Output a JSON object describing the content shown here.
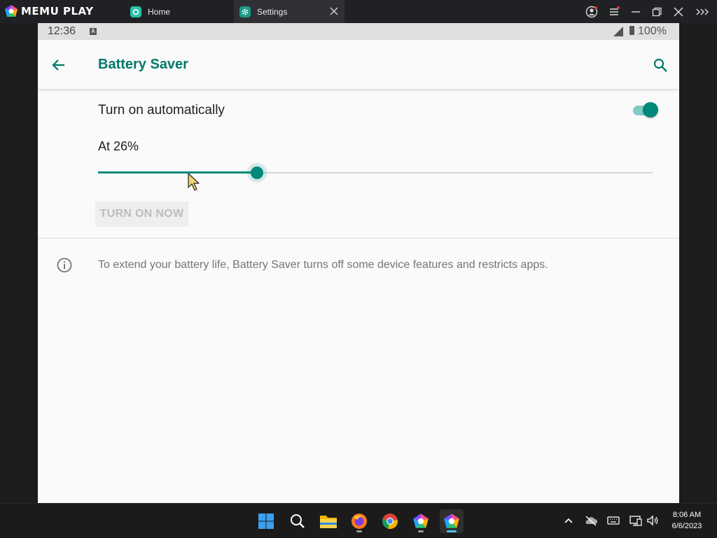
{
  "window": {
    "logo_text": "MEMU PLAY",
    "tabs": [
      {
        "label": "Home",
        "icon": "home-app-icon"
      },
      {
        "label": "Settings",
        "icon": "settings-gear-icon",
        "active": true
      }
    ]
  },
  "status_bar": {
    "time": "12:36",
    "notification_icon": "A",
    "battery": "100%"
  },
  "app_bar": {
    "title": "Battery Saver"
  },
  "content": {
    "auto_label": "Turn on automatically",
    "auto_enabled": true,
    "level_label": "At 26%",
    "slider_value_fraction": 0.286,
    "turn_on_button": "TURN ON NOW",
    "info_text": "To extend your battery life, Battery Saver turns off some device features and restricts apps."
  },
  "taskbar": {
    "apps": [
      "windows-start-icon",
      "search-icon",
      "file-explorer-icon",
      "firefox-icon",
      "chrome-icon",
      "memu-icon",
      "memu-multi-icon"
    ],
    "clock_time": "8:06 AM",
    "clock_date": "6/6/2023"
  },
  "colors": {
    "accent": "#00897b",
    "title": "#00796b"
  }
}
